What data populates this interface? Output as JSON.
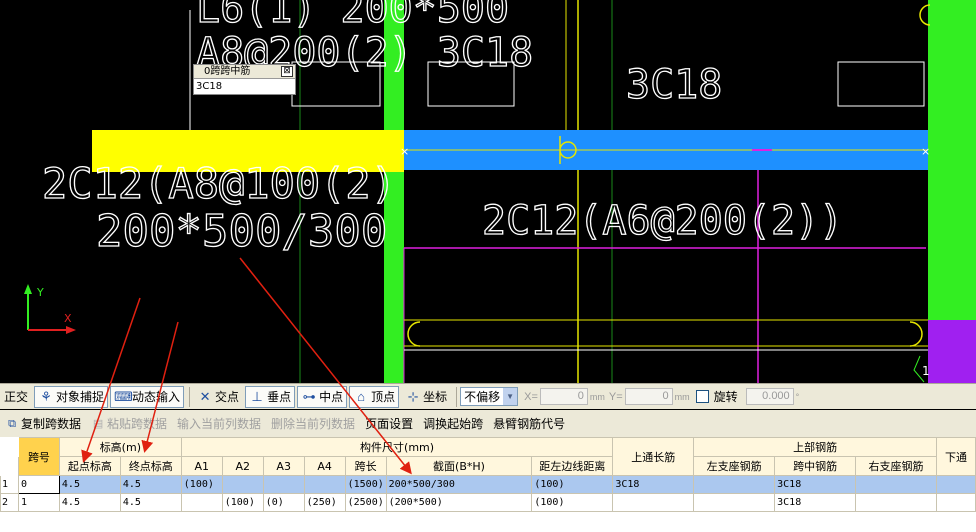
{
  "canvas": {
    "cad_texts": {
      "top_spec": "L6(1) 200*500",
      "stirrup_top": "A8@200(2) 3C18",
      "right_top_bar": "3C18",
      "left_mid": "2C12(A8@100(2)",
      "left_section": "200*500/300",
      "right_mid": "2C12(A6@200(2))",
      "corner_mark": "1"
    },
    "axis": {
      "y_label": "Y",
      "x_label": "X"
    },
    "popup": {
      "title": "0跨跨中筋",
      "value": "3C18",
      "close_glyph": "⊠"
    },
    "colors": {
      "selected_beam": "#ffff00",
      "beam": "#1e90ff",
      "column": "#33ee22",
      "column_purple": "#a020f0",
      "magenta_line": "#e020e0",
      "yellow_line": "#e6e600",
      "annot_arrow": "#e02010"
    }
  },
  "toolbar1": {
    "ortho": "正交",
    "snap": "对象捕捉",
    "dynamic_input": "动态输入",
    "intersection": "交点",
    "perpendicular": "垂点",
    "midpoint": "中点",
    "vertex": "顶点",
    "coordinate": "坐标",
    "offset_select": "不偏移",
    "x_label": "X=",
    "x_value": "0",
    "y_label": "Y=",
    "y_value": "0",
    "unit_mm": "mm",
    "rotate_label": "旋转",
    "rotate_value": "0.000",
    "degree": "°"
  },
  "toolbar2": {
    "copy_span": "复制跨数据",
    "paste_span": "粘贴跨数据",
    "input_current_col": "输入当前列数据",
    "delete_current_col": "删除当前列数据",
    "page_setup": "页面设置",
    "adjust_start_span": "调换起始跨",
    "cantilever_code": "悬臂钢筋代号"
  },
  "table": {
    "group_headers": {
      "span_no": "跨号",
      "elevation": "标高(m)",
      "member_size": "构件尺寸(mm)",
      "top_through": "上通长筋",
      "top_rebar": "上部钢筋",
      "bottom": "下通"
    },
    "sub_headers": {
      "start_elev": "起点标高",
      "end_elev": "终点标高",
      "a1": "A1",
      "a2": "A2",
      "a3": "A3",
      "a4": "A4",
      "span_len": "跨长",
      "section": "截面(B*H)",
      "dist_left_edge": "距左边线距离",
      "left_support": "左支座钢筋",
      "mid_span": "跨中钢筋",
      "right_support": "右支座钢筋"
    },
    "rows": [
      {
        "idx": "1",
        "span": "0",
        "start": "4.5",
        "end": "4.5",
        "a1": "(100)",
        "a2": "",
        "a3": "",
        "a4": "",
        "len": "(1500)",
        "section": "200*500/300",
        "dist": "(100)",
        "through": "3C18",
        "left": "",
        "mid": "3C18",
        "right": ""
      },
      {
        "idx": "2",
        "span": "1",
        "start": "4.5",
        "end": "4.5",
        "a1": "",
        "a2": "(100)",
        "a3": "(0)",
        "a4": "(250)",
        "len": "(2500)",
        "section": "(200*500)",
        "dist": "(100)",
        "through": "",
        "left": "",
        "mid": "3C18",
        "right": ""
      }
    ]
  }
}
